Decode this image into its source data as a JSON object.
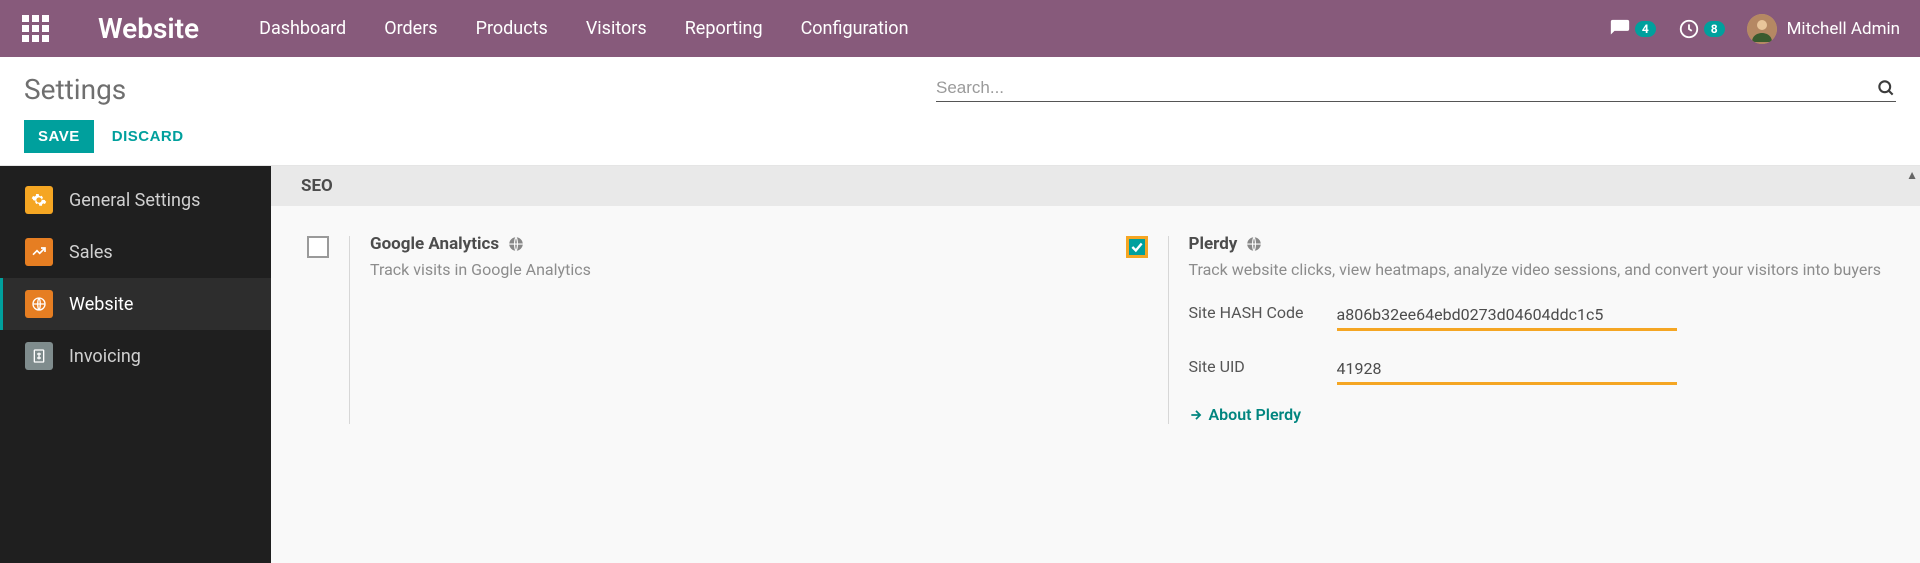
{
  "topbar": {
    "brand": "Website",
    "nav": [
      "Dashboard",
      "Orders",
      "Products",
      "Visitors",
      "Reporting",
      "Configuration"
    ],
    "messages_badge": "4",
    "activities_badge": "8",
    "username": "Mitchell Admin"
  },
  "header": {
    "title": "Settings",
    "search_placeholder": "Search...",
    "save_label": "SAVE",
    "discard_label": "DISCARD"
  },
  "sidebar": {
    "items": [
      {
        "label": "General Settings"
      },
      {
        "label": "Sales"
      },
      {
        "label": "Website"
      },
      {
        "label": "Invoicing"
      }
    ],
    "active_index": 2
  },
  "section": {
    "title": "SEO"
  },
  "settings": {
    "google_analytics": {
      "title": "Google Analytics",
      "desc": "Track visits in Google Analytics"
    },
    "plerdy": {
      "title": "Plerdy",
      "desc": "Track website clicks, view heatmaps, analyze video sessions, and convert your visitors into buyers",
      "hash_label": "Site HASH Code",
      "hash_value": "a806b32ee64ebd0273d04604ddc1c5",
      "uid_label": "Site UID",
      "uid_value": "41928",
      "about_label": "About Plerdy"
    }
  }
}
